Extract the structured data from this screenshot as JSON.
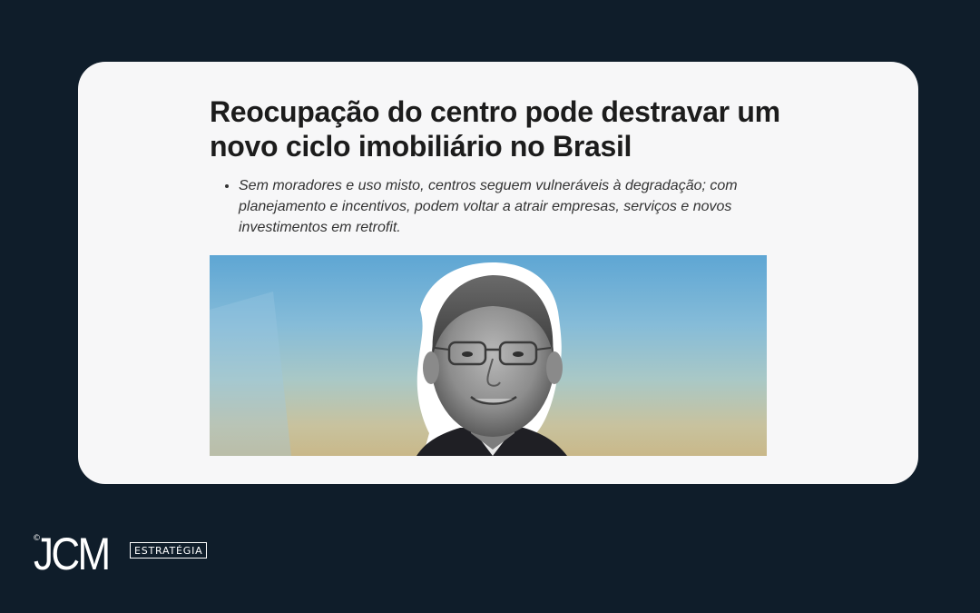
{
  "article": {
    "headline": "Reocupação do centro pode destravar um novo ciclo imobiliário no Brasil",
    "bullets": [
      "Sem moradores e uso misto, centros seguem vulneráveis à degradação; com planejamento e incentivos, podem voltar a atrair empresas, serviços e novos investimentos em retrofit."
    ],
    "photo_icon": "portrait-photo"
  },
  "brand": {
    "copyright": "©",
    "mark": "JCM",
    "tag": "ESTRATÉGIA"
  },
  "colors": {
    "background": "#0f1d2a",
    "card": "#f7f7f8",
    "headline": "#1c1c1c",
    "body_text": "#333333",
    "logo": "#ffffff"
  }
}
